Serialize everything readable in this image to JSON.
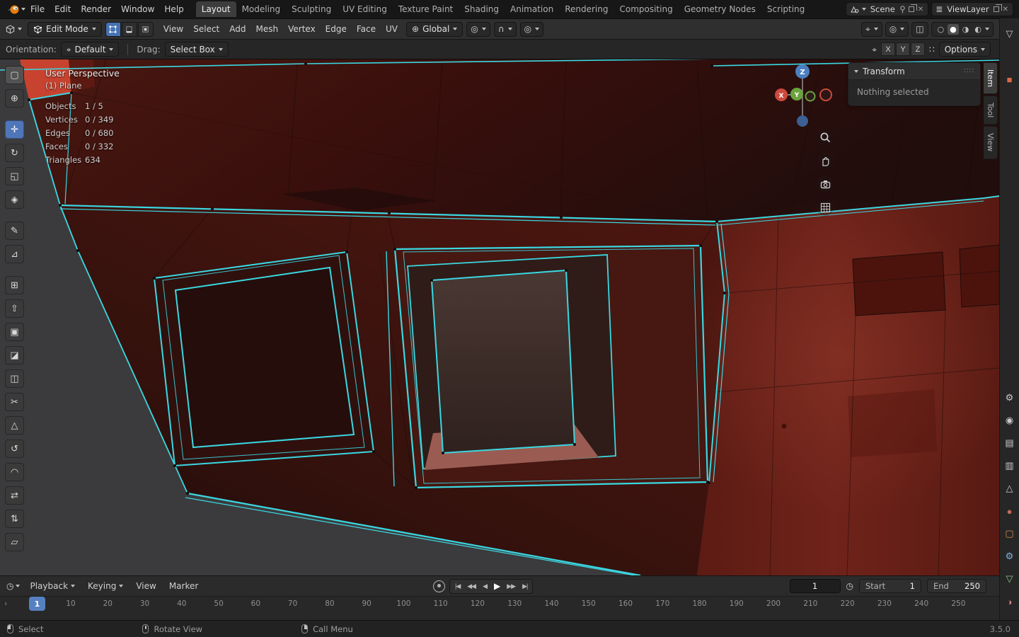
{
  "colors": {
    "selection_cyan": "#3ad8e2",
    "accent_blue": "#4772b3",
    "mesh_red": "#6e221a"
  },
  "topbar": {
    "menus": [
      "File",
      "Edit",
      "Render",
      "Window",
      "Help"
    ],
    "workspaces": [
      {
        "label": "Layout",
        "active": true
      },
      {
        "label": "Modeling"
      },
      {
        "label": "Sculpting"
      },
      {
        "label": "UV Editing"
      },
      {
        "label": "Texture Paint"
      },
      {
        "label": "Shading"
      },
      {
        "label": "Animation"
      },
      {
        "label": "Rendering"
      },
      {
        "label": "Compositing"
      },
      {
        "label": "Geometry Nodes"
      },
      {
        "label": "Scripting"
      }
    ],
    "scene_field": {
      "label": "Scene"
    },
    "viewlayer_field": {
      "label": "ViewLayer"
    }
  },
  "viewport_header": {
    "mode": "Edit Mode",
    "menus": [
      "View",
      "Select",
      "Add",
      "Mesh",
      "Vertex",
      "Edge",
      "Face",
      "UV"
    ],
    "orientation": "Global"
  },
  "tool_settings": {
    "orientation_label": "Orientation:",
    "orientation_value": "Default",
    "drag_label": "Drag:",
    "drag_value": "Select Box",
    "axes": [
      "X",
      "Y",
      "Z"
    ],
    "options_label": "Options"
  },
  "glyphs": {
    "pivot": "◎",
    "magnet": "∩",
    "proportional": "◎",
    "global_orientation": "⊕",
    "gizmo_dropdown": "⌖",
    "overlays_dropdown": "◎",
    "xray": "◫",
    "wireframe_sphere": "○",
    "solid_sphere": "●",
    "material_sphere": "◑",
    "rendered_sphere": "◐",
    "orientation_axis": "⌖",
    "snap_target": "∷",
    "transform_pivot": "⌖",
    "timeline_clock": "◷",
    "preview_clock": "◷",
    "ruler_arrow": "›",
    "layers": "≣"
  },
  "tools": [
    {
      "name": "tweak-select",
      "glyph": "▢",
      "pressed": true
    },
    {
      "name": "cursor",
      "glyph": "⊕"
    },
    {
      "name": "move",
      "glyph": "✛",
      "active": true,
      "gap": true
    },
    {
      "name": "rotate",
      "glyph": "↻"
    },
    {
      "name": "scale",
      "glyph": "◱"
    },
    {
      "name": "transform",
      "glyph": "◈"
    },
    {
      "name": "annotate",
      "glyph": "✎",
      "gap": true
    },
    {
      "name": "measure",
      "glyph": "⊿"
    },
    {
      "name": "add-cube",
      "glyph": "⊞",
      "gap": true
    },
    {
      "name": "extrude-region",
      "glyph": "⇧"
    },
    {
      "name": "inset-faces",
      "glyph": "▣"
    },
    {
      "name": "bevel",
      "glyph": "◪"
    },
    {
      "name": "loop-cut",
      "glyph": "◫"
    },
    {
      "name": "knife",
      "glyph": "✂"
    },
    {
      "name": "poly-build",
      "glyph": "△"
    },
    {
      "name": "spin",
      "glyph": "↺"
    },
    {
      "name": "smooth",
      "glyph": "◠"
    },
    {
      "name": "edge-slide",
      "glyph": "⇄"
    },
    {
      "name": "shrink-fatten",
      "glyph": "⇅"
    },
    {
      "name": "shear",
      "glyph": "▱"
    }
  ],
  "viewport": {
    "overlay": {
      "view": "User Perspective",
      "object": "(1) Plane",
      "stats": [
        {
          "label": "Objects",
          "value": "1 / 5"
        },
        {
          "label": "Vertices",
          "value": "0 / 349"
        },
        {
          "label": "Edges",
          "value": "0 / 680"
        },
        {
          "label": "Faces",
          "value": "0 / 332"
        },
        {
          "label": "Triangles",
          "value": "634"
        }
      ]
    },
    "gizmo_axes": [
      "X",
      "Y",
      "Z"
    ]
  },
  "sidebar": {
    "title": "Transform",
    "message": "Nothing selected",
    "tabs": [
      {
        "label": "Item",
        "active": true
      },
      {
        "label": "Tool"
      },
      {
        "label": "View"
      }
    ]
  },
  "properties_strip": {
    "top": [
      {
        "name": "filter",
        "glyph": "▽",
        "color": "#c9c9c9"
      },
      {
        "name": "active-object",
        "glyph": "■",
        "color": "#d96a45"
      }
    ],
    "bottom": [
      {
        "name": "tool",
        "glyph": "⚙",
        "color": "#c9c9c9"
      },
      {
        "name": "render",
        "glyph": "◉",
        "color": "#c9c9c9"
      },
      {
        "name": "output",
        "glyph": "▤",
        "color": "#c9c9c9"
      },
      {
        "name": "view-layer",
        "glyph": "▥",
        "color": "#c9c9c9"
      },
      {
        "name": "scene",
        "glyph": "△",
        "color": "#c9c9c9"
      },
      {
        "name": "world",
        "glyph": "●",
        "color": "#c26a5a"
      },
      {
        "name": "object",
        "glyph": "▢",
        "color": "#d98b4f"
      },
      {
        "name": "modifiers",
        "glyph": "⚙",
        "color": "#7fb2e5"
      },
      {
        "name": "data",
        "glyph": "▽",
        "color": "#8ec78e"
      },
      {
        "name": "material",
        "glyph": "◑",
        "color": "#d47f7f"
      }
    ]
  },
  "timeline": {
    "menus": {
      "playback": "Playback",
      "keying": "Keying",
      "view": "View",
      "marker": "Marker"
    },
    "transport": [
      {
        "name": "jump-to-start",
        "glyph": "|◀"
      },
      {
        "name": "prev-keyframe",
        "glyph": "◀◀"
      },
      {
        "name": "prev-frame",
        "glyph": "◀"
      },
      {
        "name": "play",
        "glyph": "▶",
        "active": true
      },
      {
        "name": "next-keyframe",
        "glyph": "▶▶"
      },
      {
        "name": "jump-to-end",
        "glyph": "▶|"
      }
    ],
    "current_frame": "1",
    "playhead": "1",
    "frame_ticks": [
      "10",
      "20",
      "30",
      "40",
      "50",
      "60",
      "70",
      "80",
      "90",
      "100",
      "110",
      "120",
      "130",
      "140",
      "150",
      "160",
      "170",
      "180",
      "190",
      "200",
      "210",
      "220",
      "230",
      "240",
      "250"
    ],
    "start_label": "Start",
    "start_value": "1",
    "end_label": "End",
    "end_value": "250"
  },
  "statusbar": {
    "select": "Select",
    "rotate": "Rotate View",
    "menu": "Call Menu",
    "version": "3.5.0"
  }
}
